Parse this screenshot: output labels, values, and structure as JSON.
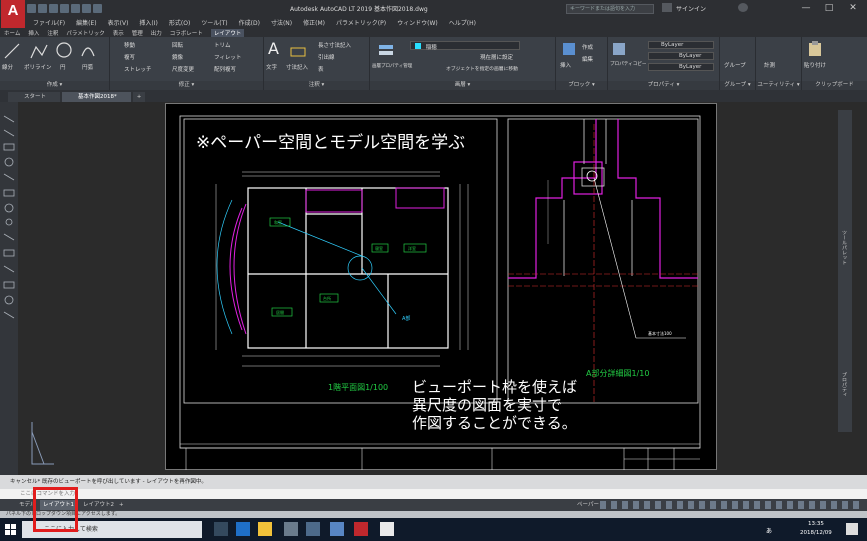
{
  "titlebar": {
    "app_logo": "A",
    "app_logo_sub": "LT",
    "title": "Autodesk AutoCAD LT 2019    基本作図2018.dwg",
    "search_placeholder": "キーワードまたは語句を入力",
    "signin": "サインイン",
    "minimize": "—",
    "maximize": "□",
    "close": "✕"
  },
  "menubar": [
    "ファイル(F)",
    "編集(E)",
    "表示(V)",
    "挿入(I)",
    "形式(O)",
    "ツール(T)",
    "作成(D)",
    "寸法(N)",
    "修正(M)",
    "パラメトリック(P)",
    "ウィンドウ(W)",
    "ヘルプ(H)"
  ],
  "ribbon_tabs": [
    {
      "label": "ホーム",
      "active": false
    },
    {
      "label": "挿入",
      "active": false
    },
    {
      "label": "注釈",
      "active": false
    },
    {
      "label": "パラメトリック",
      "active": false
    },
    {
      "label": "表示",
      "active": false
    },
    {
      "label": "管理",
      "active": false
    },
    {
      "label": "出力",
      "active": false
    },
    {
      "label": "コラボレート",
      "active": false
    },
    {
      "label": "レイアウト",
      "active": true
    }
  ],
  "ribbon": {
    "create_panel": {
      "title": "作成 ▾",
      "items": [
        "線分",
        "ポリライン",
        "円",
        "円弧"
      ]
    },
    "modify_panel": {
      "title": "修正 ▾",
      "items": [
        "移動",
        "回転",
        "トリム",
        "複写",
        "鏡像",
        "フィレット",
        "ストレッチ",
        "尺度変更",
        "配列複写"
      ]
    },
    "annotation_panel": {
      "title": "注釈 ▾",
      "items": [
        "文字",
        "寸法記入",
        "長さ寸法記入",
        "引出線",
        "表"
      ]
    },
    "layers_panel": {
      "title": "画層 ▾",
      "layer_name": "稲穂",
      "items": [
        "画層プロパティ管理",
        "現在層に設定",
        "オブジェクトを指定の画層に移動"
      ]
    },
    "block_panel": {
      "title": "ブロック ▾",
      "items": [
        "挿入",
        "作成",
        "編集"
      ]
    },
    "properties_panel": {
      "title": "プロパティ ▾",
      "items": [
        "プロパティコピー",
        "ByLayer",
        "ByLayer",
        "ByLayer"
      ]
    },
    "group_panel": {
      "title": "グループ ▾",
      "items": [
        "グループ"
      ]
    },
    "utilities_panel": {
      "title": "ユーティリティ ▾",
      "items": [
        "計測"
      ]
    },
    "clipboard_panel": {
      "title": "クリップボード",
      "items": [
        "貼り付け"
      ]
    }
  },
  "doc_tabs": [
    {
      "label": "スタート",
      "active": false
    },
    {
      "label": "基本作図2018*",
      "active": true
    }
  ],
  "drawing": {
    "heading": "※ペーパー空間とモデル空間を学ぶ",
    "left_viewport_label": "1階平面図1/100",
    "right_viewport_label": "A部分詳細図1/10",
    "overlay_text": [
      "ビューポート枠を使えば",
      "異尺度の図面を実寸で",
      "作図することができる。"
    ],
    "room_labels": [
      "和室",
      "洋室",
      "台所",
      "居間",
      "寝室"
    ],
    "detail_label": "基本寸法100",
    "section_label": "A部"
  },
  "right_palette_labels": [
    "プロパティ",
    "ツールパレット"
  ],
  "command_line": {
    "history": "キャンセル*  既存のビューポートを呼び出しています - レイアウトを再作図中。",
    "prompt_placeholder": "ここにコマンドを入力"
  },
  "layout_tabs": [
    {
      "label": "モデル",
      "active": false
    },
    {
      "label": "レイアウト1",
      "active": true
    },
    {
      "label": "レイアウト2",
      "active": false
    },
    {
      "label": "+",
      "active": false
    }
  ],
  "status_paper": "ペーパー",
  "hint": "パネル下のドロップダウン項目にアクセスします。",
  "taskbar": {
    "search_placeholder": "ここに入力して検索",
    "time": "13:35",
    "date": "2018/12/09",
    "ime": "あ"
  },
  "colors": {
    "accent_red": "#e21d1d",
    "magenta": "#e020e0",
    "green": "#22cc44",
    "cyan": "#30d0ff",
    "paper": "#000000"
  }
}
